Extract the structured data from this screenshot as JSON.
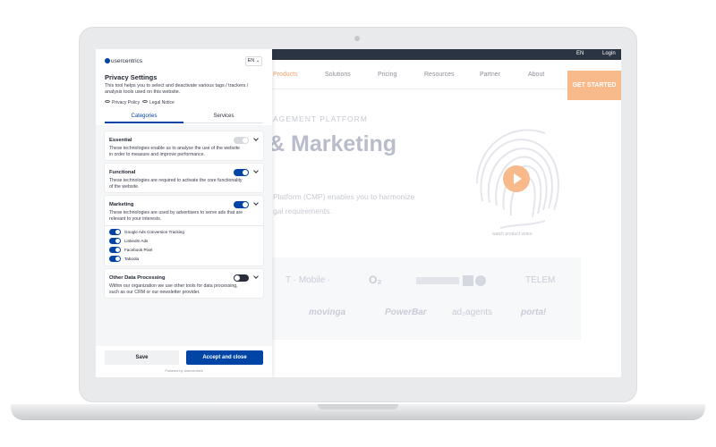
{
  "site": {
    "topbar": {
      "lang": "EN",
      "login": "Login"
    },
    "nav": [
      {
        "label": "Products",
        "active": true
      },
      {
        "label": "Solutions",
        "active": false
      },
      {
        "label": "Pricing",
        "active": false
      },
      {
        "label": "Resources",
        "active": false
      },
      {
        "label": "Partner",
        "active": false
      },
      {
        "label": "About",
        "active": false
      }
    ],
    "cta": "GET STARTED",
    "hero_kicker": "AGEMENT PLATFORM",
    "hero_title": "& Marketing",
    "hero_line1": "Platform (CMP) enables you to harmonize",
    "hero_line2": "gal requirements.",
    "watch": "watch product video",
    "logos_row1": [
      "T · Mobile ·",
      "O₂",
      "TELEM"
    ],
    "logos_row2": [
      "movinga",
      "PowerBar",
      "ad₂agents",
      "porta!"
    ],
    "accent": "#f8b98b"
  },
  "panel": {
    "brand": "usercentrics",
    "lang": "EN",
    "title": "Privacy Settings",
    "description": "This tool helps you to select and deactivate various tags / trackers / analysis tools used on this website.",
    "links": {
      "privacy": "Privacy Policy",
      "legal": "Legal Notice"
    },
    "tabs": {
      "categories": "Categories",
      "services": "Services"
    },
    "categories": [
      {
        "title": "Essential",
        "desc": "These technologies enable us to analyse the use of the website in order to measure and improve performance.",
        "state": "disabled"
      },
      {
        "title": "Functional",
        "desc": "These technologies are required to activate the core functionality of the website.",
        "state": "on"
      },
      {
        "title": "Marketing",
        "desc": "These technologies are used by advertisers to serve ads that are relevant to your interests.",
        "state": "on"
      },
      {
        "title": "Other Data Processing",
        "desc": "Within our organization we use other tools for data processing, such as our CRM or our newsletter provider.",
        "state": "off"
      }
    ],
    "marketing_services": [
      "Google Ads Conversion Tracking",
      "LinkedIn Ads",
      "Facebook Pixel",
      "Taboola"
    ],
    "buttons": {
      "save": "Save",
      "accept": "Accept and close"
    },
    "powered": "Powered by Usercentrics",
    "brand_color": "#0045a5"
  }
}
